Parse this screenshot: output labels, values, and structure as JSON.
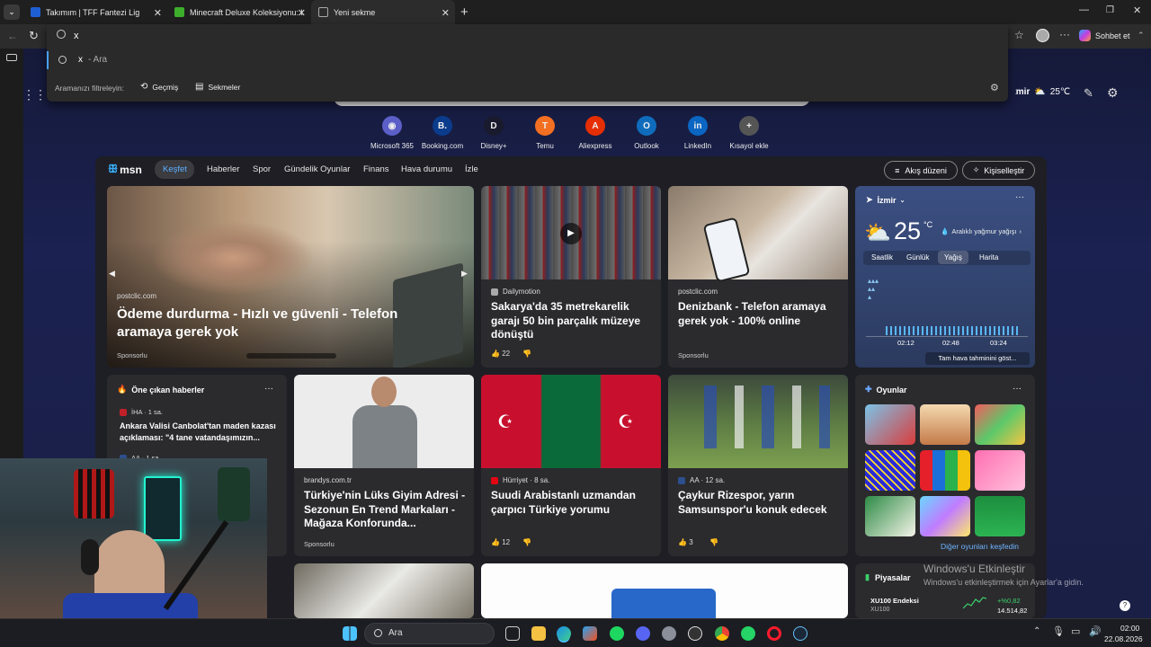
{
  "tabs": [
    {
      "label": "Takımım | TFF Fantezi Lig",
      "favicon_color": "#1f5fd4"
    },
    {
      "label": "Minecraft Deluxe Koleksiyonu: Bed",
      "favicon_color": "#3dae2b"
    },
    {
      "label": "Yeni sekme",
      "favicon_color": "#888888"
    }
  ],
  "omnibox": {
    "value": "x",
    "suggestion": "x",
    "suggestion_suffix": "- Ara",
    "filter_label": "Aramanızı filtreleyin:",
    "filters": [
      "Geçmiş",
      "Sekmeler"
    ]
  },
  "toolbar": {
    "chat_label": "Sohbet et"
  },
  "weather_top": {
    "city": "İzmir",
    "temp": "25℃"
  },
  "shortcuts": [
    {
      "label": "Microsoft 365",
      "color": "#5b5fc7",
      "glyph": "◉"
    },
    {
      "label": "Booking.com",
      "color": "#0b3c8c",
      "glyph": "B."
    },
    {
      "label": "Disney+",
      "color": "#1a1a2e",
      "glyph": "D"
    },
    {
      "label": "Temu",
      "color": "#f36f21",
      "glyph": "T"
    },
    {
      "label": "Aliexpress",
      "color": "#e62e04",
      "glyph": "A"
    },
    {
      "label": "Outlook",
      "color": "#0f6cbd",
      "glyph": "O"
    },
    {
      "label": "LinkedIn",
      "color": "#0a66c2",
      "glyph": "in"
    },
    {
      "label": "Kısayol ekle",
      "color": "#555555",
      "glyph": "+"
    }
  ],
  "msn": {
    "logo": "msn",
    "nav": [
      "Keşfet",
      "Haberler",
      "Spor",
      "Gündelik Oyunlar",
      "Finans",
      "Hava durumu",
      "İzle"
    ],
    "layout_btn": "Akış düzeni",
    "personalize_btn": "Kişiselleştir"
  },
  "hero": {
    "source": "postclic.com",
    "title": "Ödeme durdurma - Hızlı ve güvenli - Telefon aramaya gerek yok",
    "sponsored": "Sponsorlu"
  },
  "card_garage": {
    "source": "Dailymotion",
    "title": "Sakarya'da 35 metrekarelik garajı 50 bin parçalık müzeye dönüştü",
    "likes": "22"
  },
  "card_denizbank": {
    "source": "postclic.com",
    "title": "Denizbank - Telefon aramaya gerek yok - 100% online",
    "sponsored": "Sponsorlu"
  },
  "weather_card": {
    "city": "İzmir",
    "temp": "25",
    "unit": "°C",
    "desc": "Aralıklı yağmur yağışı",
    "tabs": [
      "Saatlik",
      "Günlük",
      "Yağış",
      "Harita"
    ],
    "times": [
      "02:12",
      "02:48",
      "03:24"
    ],
    "link": "Tam hava tahminini göst..."
  },
  "top_news": {
    "title": "Öne çıkan haberler",
    "item1_source": "İHA · 1 sa.",
    "item1_text": "Ankara Valisi Canbolat'tan maden kazası açıklaması: \"4 tane vatandaşımızın...",
    "item2_source": "AA · 1 sa."
  },
  "card_boss": {
    "source": "brandys.com.tr",
    "title": "Türkiye'nin Lüks Giyim Adresi - Sezonun En Trend Markaları - Mağaza Konforunda...",
    "sponsored": "Sponsorlu"
  },
  "card_flags": {
    "source": "Hürriyet · 8 sa.",
    "title": "Suudi Arabistanlı uzmandan çarpıcı Türkiye yorumu",
    "likes": "12"
  },
  "card_football": {
    "source": "AA · 12 sa.",
    "title": "Çaykur Rizespor, yarın Samsunspor'u konuk edecek",
    "likes": "3"
  },
  "games": {
    "title": "Oyunlar",
    "more": "Diğer oyunları keşfedin"
  },
  "markets": {
    "title": "Piyasalar",
    "ticker": "XU100 Endeksi",
    "ticker_sub": "XU100",
    "change": "+%0,82",
    "value": "14.514,82"
  },
  "watermark": {
    "line1": "Windows'u Etkinleştir",
    "line2": "Windows'u etkinleştirmek için Ayarlar'a gidin."
  },
  "taskbar": {
    "search_placeholder": "Ara",
    "time": "02:00",
    "date": "22.08.2026"
  }
}
